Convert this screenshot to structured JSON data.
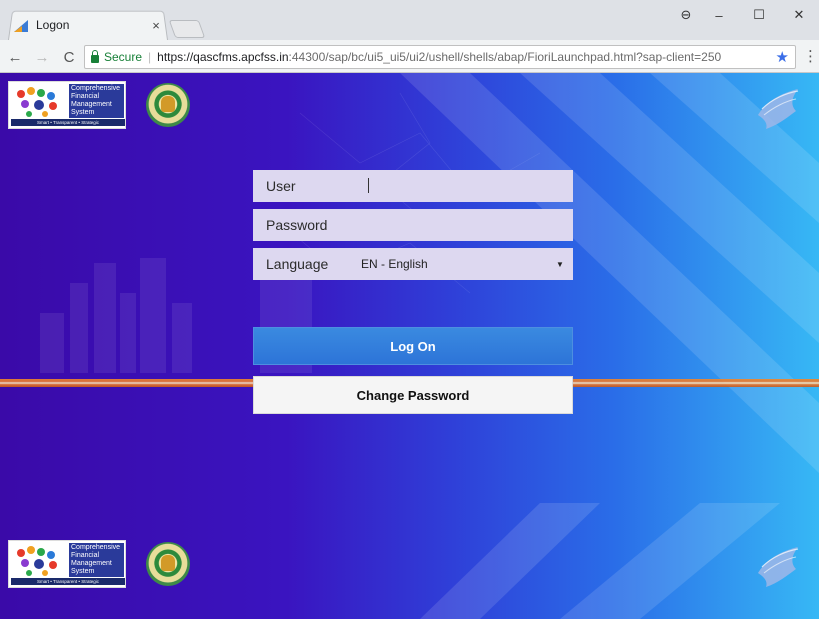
{
  "browser": {
    "tab_title": "Logon",
    "tab_close": "×",
    "window_controls": {
      "account": "⊖",
      "minimize": "–",
      "maximize": "☐",
      "close": "✕"
    },
    "nav": {
      "back": "←",
      "forward": "→",
      "reload": "C"
    },
    "secure_label": "Secure",
    "separator": "|",
    "url_host": "https://qascfms.apcfss.in",
    "url_path": ":44300/sap/bc/ui5_ui5/ui2/ushell/shells/abap/FioriLaunchpad.html?sap-client=250",
    "bookmark_star": "★",
    "menu": "⋮"
  },
  "branding": {
    "cfms_name": "Comprehensive Financial Management System",
    "cfms_tagline": "Smart • Transparent • Strategic"
  },
  "form": {
    "user_label": "User",
    "user_value": "",
    "password_label": "Password",
    "password_value": "",
    "language_label": "Language",
    "language_value": "EN - English",
    "language_arrow": "▼",
    "logon_label": "Log On",
    "change_password_label": "Change Password"
  },
  "colors": {
    "logon_button": "#2d74d8",
    "bg_left": "#3a0aa8",
    "bg_right": "#37b8f5",
    "stripe": "#e8742a"
  }
}
